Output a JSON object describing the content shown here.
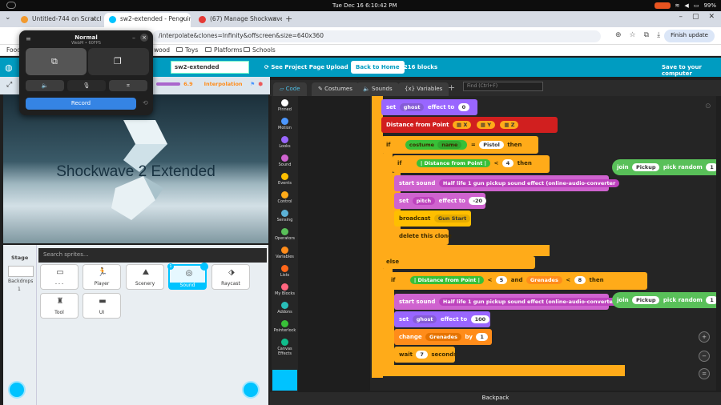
{
  "system": {
    "clock": "Tue Dec 16   6:10:42 PM",
    "battery": "99%"
  },
  "browser": {
    "tabs": [
      {
        "label": "Untitled-744 on Scratch"
      },
      {
        "label": "sw2-extended - Penguin"
      },
      {
        "label": "(67) Manage Shockwave"
      }
    ],
    "url": "/interpolate&clones=Infinity&offscreen&size=640x360",
    "finish_update": "Finish update",
    "bookmarks": [
      "Food",
      "wood",
      "Toys",
      "Platforms",
      "Schools"
    ]
  },
  "menubar": {
    "project_name": "sw2-extended",
    "see_project_page": "See Project Page",
    "upload": "Upload",
    "back_home": "Back to Home",
    "block_count": "3216 blocks",
    "save": "Save to your computer"
  },
  "stage": {
    "volume": "6.9",
    "interpolation": "Interpolation",
    "title_text": "Shockwave 2 Extended"
  },
  "sprites_pane": {
    "stage_label": "Stage",
    "backdrops_label": "Backdrops",
    "backdrop_count": "1",
    "search_placeholder": "Search sprites...",
    "sprites": [
      {
        "name": "- - -"
      },
      {
        "name": "Player"
      },
      {
        "name": "Scenery"
      },
      {
        "name": "Sound",
        "selected": true,
        "badge": "1"
      },
      {
        "name": "Raycast"
      },
      {
        "name": "Tool"
      },
      {
        "name": "UI"
      }
    ]
  },
  "editor": {
    "tabs": [
      "Code",
      "Costumes",
      "Sounds",
      "Variables"
    ],
    "find_placeholder": "Find (Ctrl+F)",
    "categories": [
      {
        "name": "Pinned",
        "color": "#ffffff"
      },
      {
        "name": "Motion",
        "color": "#4c97ff"
      },
      {
        "name": "Looks",
        "color": "#9966ff"
      },
      {
        "name": "Sound",
        "color": "#cf63cf"
      },
      {
        "name": "Events",
        "color": "#ffbf00"
      },
      {
        "name": "Control",
        "color": "#ffab19"
      },
      {
        "name": "Sensing",
        "color": "#5cb1d6"
      },
      {
        "name": "Operators",
        "color": "#59c059"
      },
      {
        "name": "Variables",
        "color": "#ff8c1a"
      },
      {
        "name": "Lists",
        "color": "#ff661a"
      },
      {
        "name": "My Blocks",
        "color": "#ff6680"
      },
      {
        "name": "Addons",
        "color": "#29beb8"
      },
      {
        "name": "Pointerlock",
        "color": "#38c038"
      },
      {
        "name": "Canvas Effects",
        "color": "#0fbd8c"
      }
    ],
    "backpack": "Backpack"
  },
  "blocks": {
    "set": "set",
    "ghost": "ghost",
    "effect_to": "effect to",
    "zero": "0",
    "distance_from_point": "Distance from Point",
    "x": "X",
    "y": "Y",
    "z": "Z",
    "if": "if",
    "then": "then",
    "costume": "costume",
    "name": "name",
    "equals": "=",
    "pistol": "Pistol",
    "lt": "<",
    "four": "4",
    "start_sound": "start sound",
    "sound_name": "Half life 1 gun pickup sound effect (online-audio-converter",
    "pitch": "pitch",
    "effect_by": "effect to",
    "neg20": "-20",
    "broadcast": "broadcast",
    "gun_start": "Gun Start",
    "delete_clone": "delete this clone",
    "else": "else",
    "five": "5",
    "and": "and",
    "grenades": "Grenades",
    "eight": "8",
    "hundred": "100",
    "change": "change",
    "by": "by",
    "one": "1",
    "wait": "wait",
    "seven": "7",
    "seconds": "seconds",
    "join": "join",
    "pickup": "Pickup",
    "pick_random": "pick random",
    "to_cut": "t"
  },
  "recorder": {
    "title": "Normal",
    "subtitle": "WebM • 60FPS",
    "record": "Record"
  }
}
